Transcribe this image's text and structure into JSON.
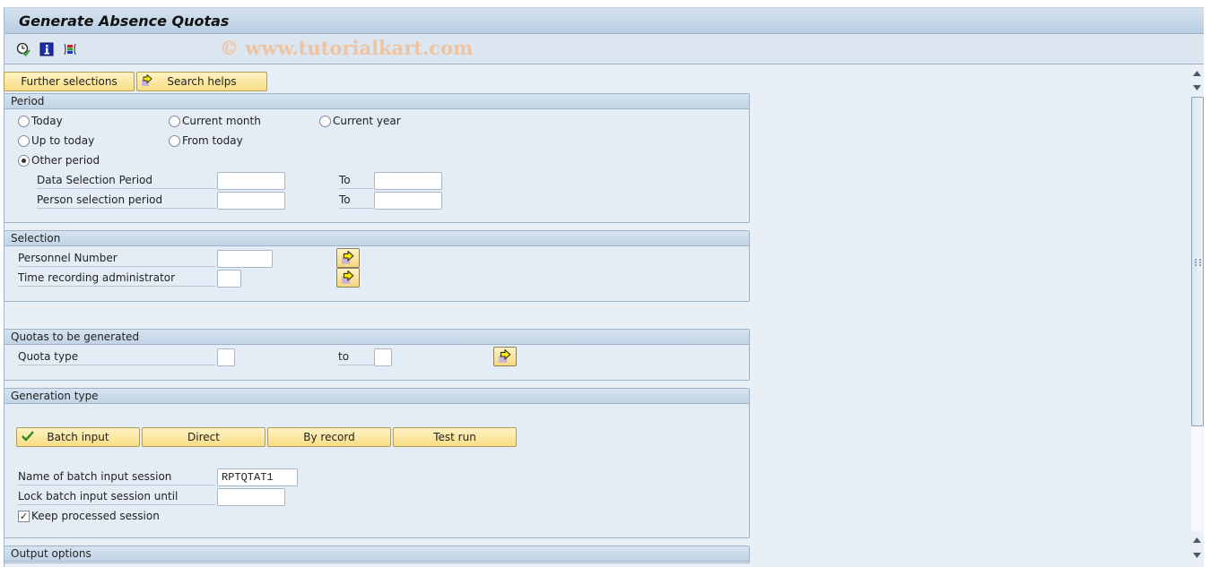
{
  "window": {
    "title": "Generate Absence Quotas",
    "watermark": "© www.tutorialkart.com"
  },
  "toolbar": {
    "icons": [
      "execute-clock-icon",
      "info-icon",
      "selection-options-icon"
    ]
  },
  "top_buttons": {
    "further_selections": "Further selections",
    "search_helps": "Search helps"
  },
  "period": {
    "title": "Period",
    "options": [
      {
        "label": "Today",
        "selected": false
      },
      {
        "label": "Current month",
        "selected": false
      },
      {
        "label": "Current year",
        "selected": false
      },
      {
        "label": "Up to today",
        "selected": false
      },
      {
        "label": "From today",
        "selected": false
      },
      {
        "label": "Other period",
        "selected": true
      }
    ],
    "data_selection_label": "Data Selection Period",
    "data_selection_from": "",
    "data_selection_to_label": "To",
    "data_selection_to": "",
    "person_selection_label": "Person selection period",
    "person_selection_from": "",
    "person_selection_to_label": "To",
    "person_selection_to": ""
  },
  "selection": {
    "title": "Selection",
    "personnel_number_label": "Personnel Number",
    "personnel_number": "",
    "time_admin_label": "Time recording administrator",
    "time_admin": ""
  },
  "quotas": {
    "title": "Quotas to be generated",
    "quota_type_label": "Quota type",
    "quota_type_from": "",
    "to_label": "to",
    "quota_type_to": ""
  },
  "generation": {
    "title": "Generation type",
    "buttons": {
      "batch_input": "Batch input",
      "direct": "Direct",
      "by_record": "By record",
      "test_run": "Test run"
    },
    "active_button": "Batch input",
    "session_name_label": "Name of batch input session",
    "session_name": "RPTQTAT1",
    "lock_until_label": "Lock batch input session until",
    "lock_until": "",
    "keep_session_label": "Keep processed session",
    "keep_session_checked": true
  },
  "output": {
    "title": "Output options"
  }
}
